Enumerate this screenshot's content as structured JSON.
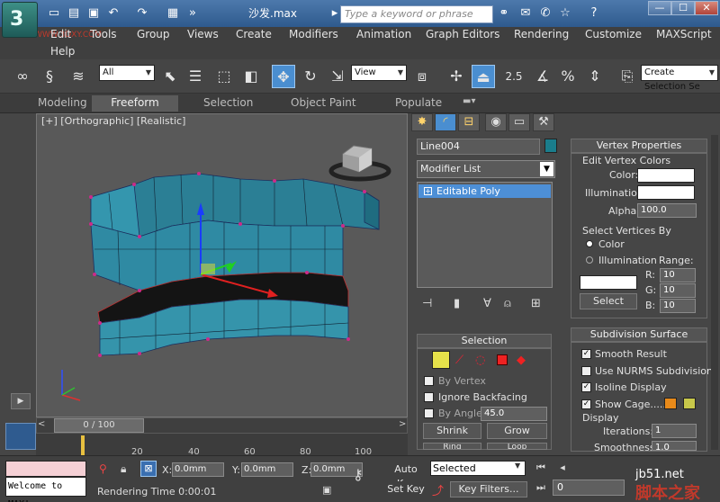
{
  "title_bar": {
    "doc_title": "沙发.max",
    "search_placeholder": "Type a keyword or phrase",
    "window_buttons": [
      "—",
      "☐",
      "✕"
    ]
  },
  "menu": [
    "Edit",
    "Tools",
    "Group",
    "Views",
    "Create",
    "Modifiers",
    "Animation",
    "Graph Editors",
    "Rendering",
    "Customize",
    "MAXScript",
    "Help"
  ],
  "watermark_top": "WWW.3DXY.COM",
  "toolbar": {
    "selection_filter": "All",
    "ref_coord": "View",
    "named_selection": "Create Selection Se",
    "snap_label": "2.5"
  },
  "ribbon_tabs": [
    "Modeling",
    "Freeform",
    "Selection",
    "Object Paint",
    "Populate"
  ],
  "viewport": {
    "label": "[+] [Orthographic] [Realistic]"
  },
  "command_panel": {
    "object_name": "Line004",
    "object_color": "#1a7d8c",
    "modifier_list": "Modifier List",
    "stack_item": "Editable Poly"
  },
  "selection_rollout": {
    "title": "Selection",
    "by_vertex": "By Vertex",
    "ignore_backfacing": "Ignore Backfacing",
    "by_angle": "By Angle:",
    "angle_value": "45.0",
    "shrink": "Shrink",
    "grow": "Grow",
    "ring": "Ring",
    "loop": "Loop"
  },
  "vertex_props": {
    "title": "Vertex Properties",
    "edit_colors": "Edit Vertex Colors",
    "color": "Color:",
    "illumination": "Illumination:",
    "alpha": "Alpha:",
    "alpha_value": "100.0",
    "select_by": "Select Vertices By",
    "by_color": "Color",
    "by_illum": "Illumination",
    "range": "Range:",
    "r_label": "R:",
    "g_label": "G:",
    "b_label": "B:",
    "r": "10",
    "g": "10",
    "b": "10",
    "select_btn": "Select"
  },
  "subdivision": {
    "title": "Subdivision Surface",
    "smooth_result": "Smooth Result",
    "use_nurms": "Use NURMS Subdivision",
    "isoline": "Isoline Display",
    "show_cage": "Show Cage......",
    "cage_color1": "#e88a1a",
    "cage_color2": "#c8c84a",
    "display": "Display",
    "iterations_label": "Iterations:",
    "iterations": "1",
    "smoothness_label": "Smoothness:",
    "smoothness": "1.0"
  },
  "timeline": {
    "slider": "0 / 100",
    "ticks": [
      "20",
      "40",
      "60",
      "80",
      "100"
    ]
  },
  "status": {
    "welcome": "Welcome to MAX!",
    "render_time": "Rendering Time  0:00:01",
    "x_label": "X:",
    "y_label": "Y:",
    "z_label": "Z:",
    "x": "0.0mm",
    "y": "0.0mm",
    "z": "0.0mm",
    "auto_key": "Auto Key",
    "set_key": "Set Key",
    "key_mode": "Selected",
    "key_filters": "Key Filters...",
    "frame": "0"
  },
  "watermark_bottom_1": "jb51.net",
  "watermark_bottom_2": "脚本之家"
}
